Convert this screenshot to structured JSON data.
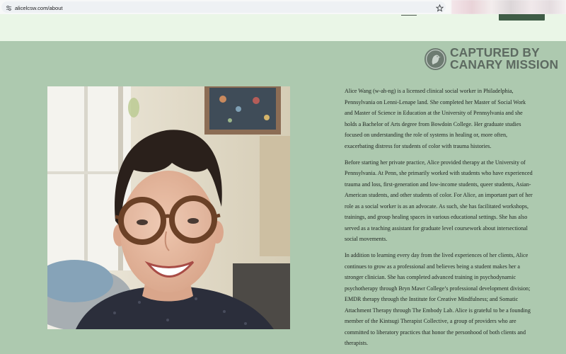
{
  "browser": {
    "url": "alicelcsw.com/about",
    "icons": {
      "site_info": "tune-icon",
      "bookmark": "star-icon"
    }
  },
  "stamp": {
    "line1": "CAPTURED BY",
    "line2": "CANARY MISSION",
    "icon": "canary-bird-icon"
  },
  "bio": {
    "paragraphs": [
      {
        "lines": [
          "Alice Wang (w-ah-ng) is a licensed clinical social worker in Philadelphia,",
          "Pennsylvania on Lenni-Lenape land. She completed her Master of Social Work",
          "and Master of Science in Education at the University of Pennsylvania and she",
          "holds a Bachelor of Arts degree from Bowdoin College. Her graduate studies",
          "focused on understanding the role of systems in healing or, more often,",
          "exacerbating distress for students of color with trauma histories."
        ]
      },
      {
        "lines": [
          "Before starting her private practice, Alice provided therapy at the University of",
          "Pennsylvania. At Penn, she primarily worked with students who have experienced",
          "trauma and loss, first-generation and low-income students, queer students, Asian-",
          "American students, and other students of color. For Alice, an important part of her",
          "role as a social worker is as an advocate. As such, she has facilitated workshops,",
          "trainings, and group healing spaces in various educational settings. She has also",
          "served as a teaching assistant for graduate level coursework about intersectional",
          "social movements."
        ]
      },
      {
        "lines": [
          "In addition to learning every day from the lived experiences of her clients, Alice",
          "continues to grow as a professional and believes being a student makes her a",
          "stronger clinician. She has completed advanced training in psychodynamic",
          "psychotherapy through Bryn Mawr College’s professional development division;",
          "EMDR therapy through the Institute for Creative Mindfulness; and Somatic",
          "Attachment Therapy through The Embody Lab. Alice is grateful to be a founding",
          "member of the Kintsugi Therapist Collective, a group of providers who are",
          "committed to liberatory practices that honor the personhood of both clients and",
          "therapists."
        ]
      }
    ]
  },
  "colors": {
    "header_bg": "#eaf6e7",
    "page_bg": "#adc9af",
    "header_button": "#3f5c46",
    "stamp": "#5d6a61",
    "text": "#1f2420"
  }
}
